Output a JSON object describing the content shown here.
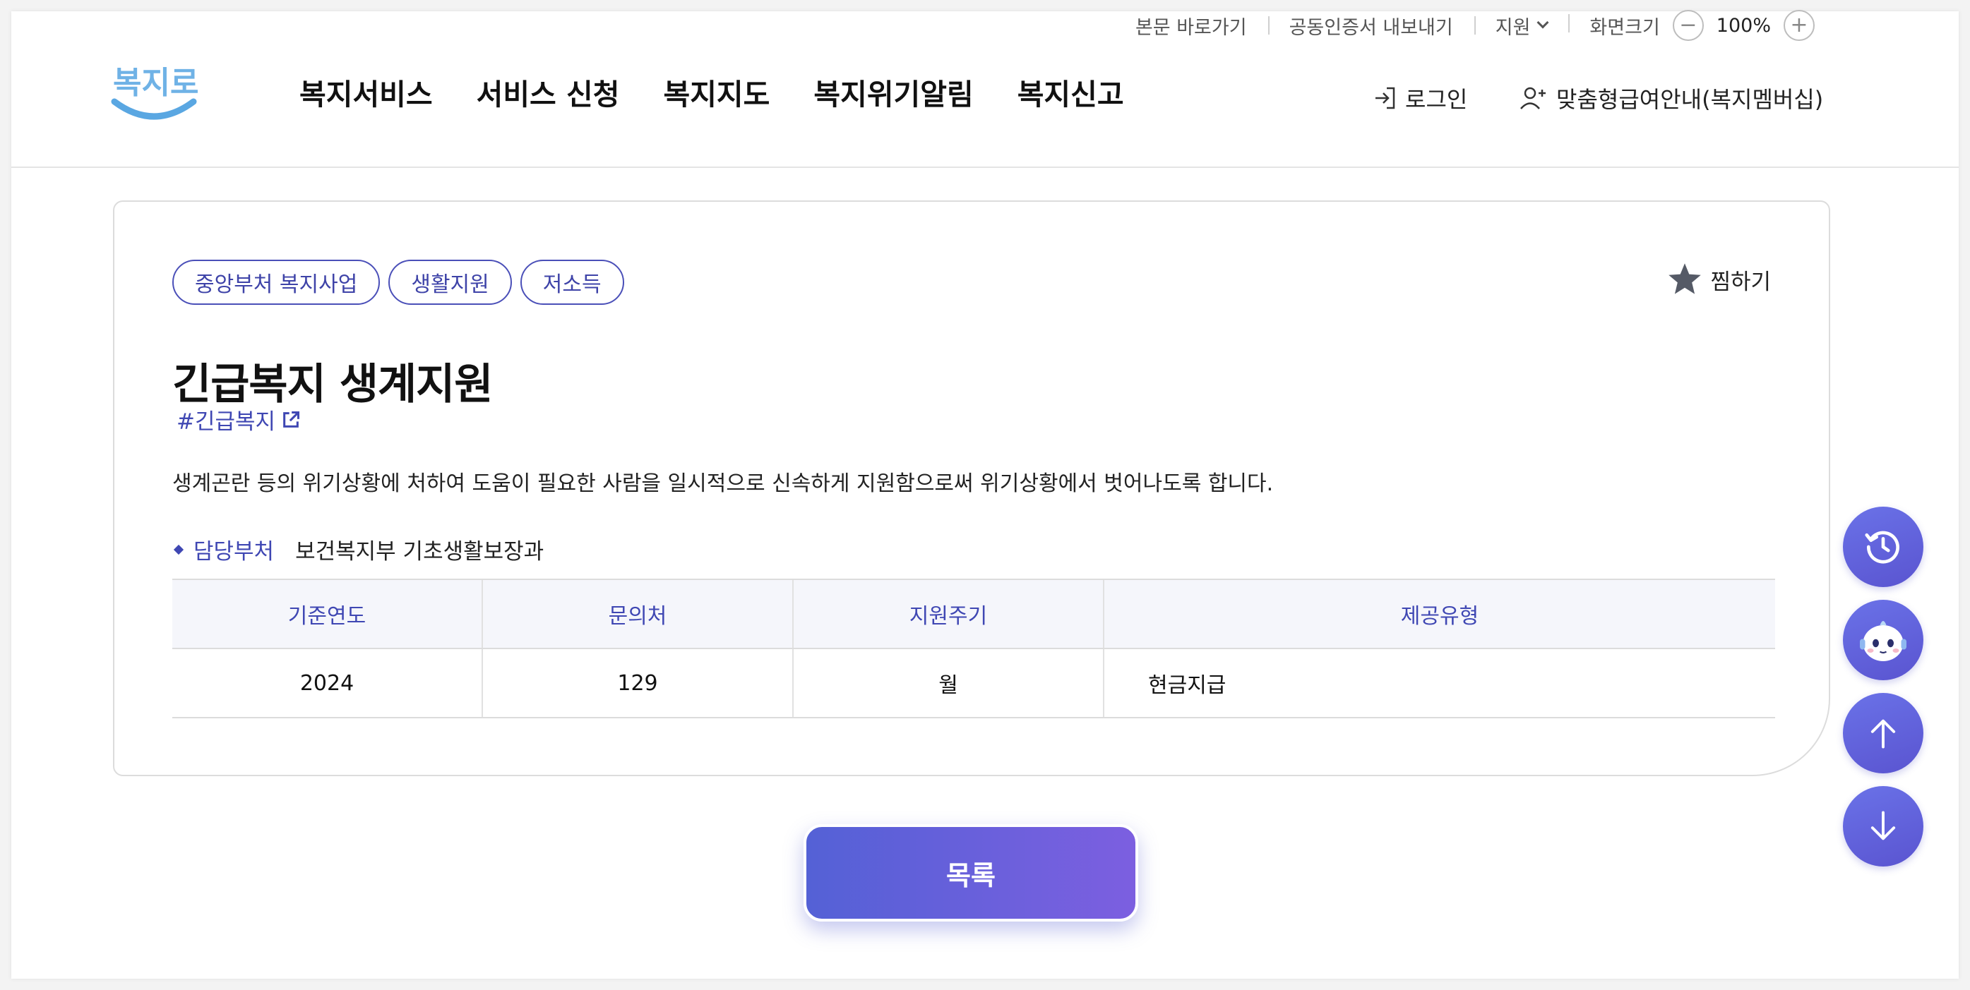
{
  "utility": {
    "skip_link": "본문 바로가기",
    "cert_export": "공동인증서 내보내기",
    "support": "지원",
    "screen_size": "화면크기",
    "zoom_value": "100%"
  },
  "header": {
    "logo_text": "복지로",
    "nav": [
      "복지서비스",
      "서비스 신청",
      "복지지도",
      "복지위기알림",
      "복지신고"
    ],
    "login": "로그인",
    "membership": "맞춤형급여안내(복지멤버십)"
  },
  "detail": {
    "tags": [
      "중앙부처 복지사업",
      "생활지원",
      "저소득"
    ],
    "favorite": "찜하기",
    "title": "긴급복지 생계지원",
    "hashtag": "#긴급복지",
    "description": "생계곤란 등의 위기상황에 처하여 도움이 필요한 사람을 일시적으로 신속하게 지원함으로써 위기상황에서 벗어나도록 합니다.",
    "dept_label": "담당부처",
    "dept_value": "보건복지부 기초생활보장과",
    "table": {
      "headers": [
        "기준연도",
        "문의처",
        "지원주기",
        "제공유형"
      ],
      "row": [
        "2024",
        "129",
        "월",
        "현금지급"
      ]
    }
  },
  "list_button": "목록",
  "colors": {
    "accent": "#3f47b3",
    "button_gradient_start": "#5461d6",
    "button_gradient_end": "#7c5fe0"
  },
  "floating_icons": [
    "history-icon",
    "chatbot-icon",
    "arrow-up-icon",
    "arrow-down-icon"
  ]
}
